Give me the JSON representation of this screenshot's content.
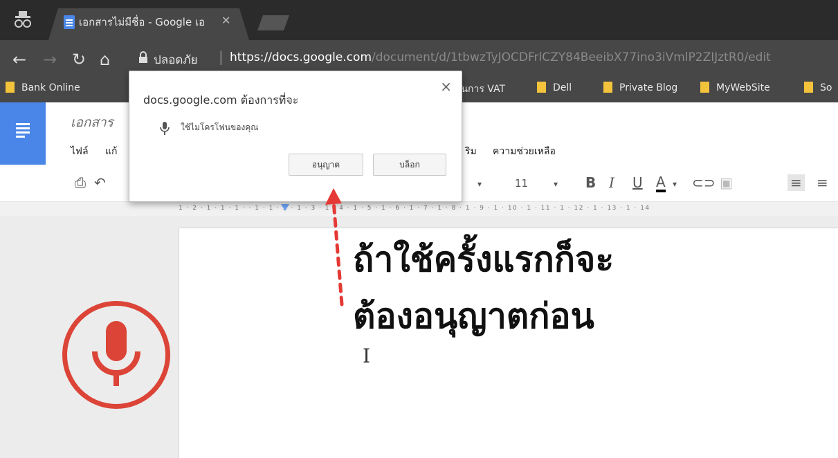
{
  "browser": {
    "tab_title": "เอกสารไม่มีชื่อ - Google เอ",
    "secure_label": "ปลอดภัย",
    "url_host": "https://docs.google.com",
    "url_path": "/document/d/1tbwzTyJOCDFrlCZY84BeeibX77ino3iVmlP2ZIJztR0/edit",
    "bookmarks": [
      "Bank Online",
      "อนการ VAT",
      "Dell",
      "Private Blog",
      "MyWebSite",
      "So"
    ]
  },
  "docs": {
    "title": "เอกสาร",
    "menu": [
      "ไฟล์",
      "แก้",
      "ริม",
      "ความช่วยเหลือ"
    ],
    "font_size": "11",
    "ruler": "1 · 2 · 1 · 1 · 1 ·   · 1 · 1 · 2 · 1 · 3 · 1 · 4 · 1 · 5 · 1 · 6 · 1 · 7 · 1 · 8 · 1 · 9 · 1 · 10 · 1 · 11 · 1 · 12 · 1 · 13 · 1 · 14"
  },
  "popup": {
    "title": "docs.google.com ต้องการที่จะ",
    "permission": "ใช้ไมโครโฟนของคุณ",
    "allow_label": "อนุญาต",
    "block_label": "บล็อก",
    "close_glyph": "×"
  },
  "annotation": {
    "line1": "ถ้าใช้ครั้งแรกก็จะ",
    "line2": "ต้องอนุญาตก่อน"
  },
  "colors": {
    "mic_red": "#db4437",
    "docs_blue": "#4a86e8",
    "arrow_red": "#e53935"
  }
}
